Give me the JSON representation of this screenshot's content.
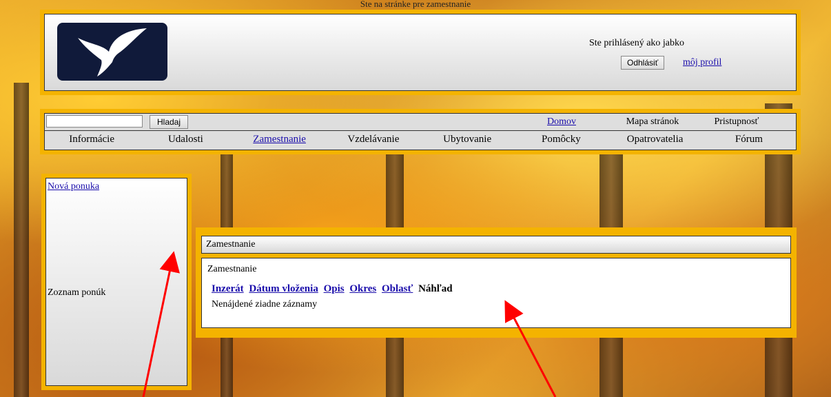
{
  "caption": "Ste na stránke pre zamestnanie",
  "header": {
    "login_text": "Ste prihlásený ako  jabko",
    "logout_label": "Odhlásiť",
    "profile_link": "môj profil"
  },
  "nav": {
    "search_button": "Hladaj",
    "search_value": "",
    "utility_links": [
      "Domov",
      "Mapa stránok",
      "Pristupnosť"
    ],
    "menu": [
      "Informácie",
      "Udalosti",
      "Zamestnanie",
      "Vzdelávanie",
      "Ubytovanie",
      "Pomôcky",
      "Opatrovatelia",
      "Fórum"
    ],
    "active_menu": "Zamestnanie"
  },
  "sidebar": {
    "new_offer_link": "Nová ponuka",
    "list_label": "Zoznam ponúk"
  },
  "content": {
    "title": "Zamestnanie",
    "heading": "Zamestnanie",
    "columns": [
      "Inzerát",
      "Dátum vloženia",
      "Opis",
      "Okres",
      "Oblasť"
    ],
    "preview_label": "Náhľad",
    "empty_message": "Nenájdené ziadne záznamy"
  },
  "colors": {
    "frame": "#f4b300",
    "link": "#1a0dab",
    "arrow": "#ff0000"
  },
  "icons": {
    "logo": "dove-logo-icon"
  }
}
